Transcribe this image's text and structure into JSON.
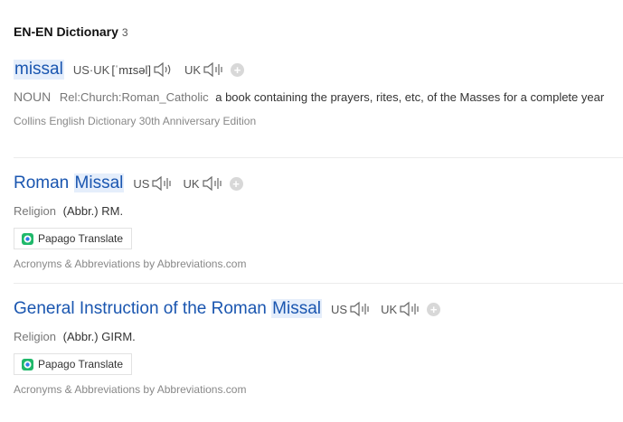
{
  "section": {
    "title": "EN-EN Dictionary",
    "count": "3"
  },
  "entries": [
    {
      "headword": "missal",
      "pron_label_a": "US",
      "pron_sep": "·",
      "pron_label_b": "UK",
      "phonetic": "[ˈmɪsəl]",
      "uk_label": "UK",
      "pos": "NOUN",
      "rel": "Rel:Church:Roman_Catholic",
      "definition": "a book containing the prayers, rites, etc, of the Masses for a complete year",
      "source": "Collins English Dictionary 30th Anniversary Edition"
    },
    {
      "headword_pre": "Roman ",
      "headword_hl": "Missal",
      "us_label": "US",
      "uk_label": "UK",
      "domain": "Religion",
      "abbr": "(Abbr.) RM.",
      "translate_label": "Papago Translate",
      "source": "Acronyms & Abbreviations by Abbreviations.com"
    },
    {
      "headword_pre": "General Instruction of the Roman ",
      "headword_hl": "Missal",
      "us_label": "US",
      "uk_label": "UK",
      "domain": "Religion",
      "abbr": "(Abbr.) GIRM.",
      "translate_label": "Papago Translate",
      "source": "Acronyms & Abbreviations by Abbreviations.com"
    }
  ],
  "icons": {
    "speaker": "speaker-icon",
    "add": "add-icon",
    "papago": "papago-icon"
  },
  "colors": {
    "headword": "#1a56b0",
    "highlight": "#e5eefb",
    "muted": "#888888"
  }
}
